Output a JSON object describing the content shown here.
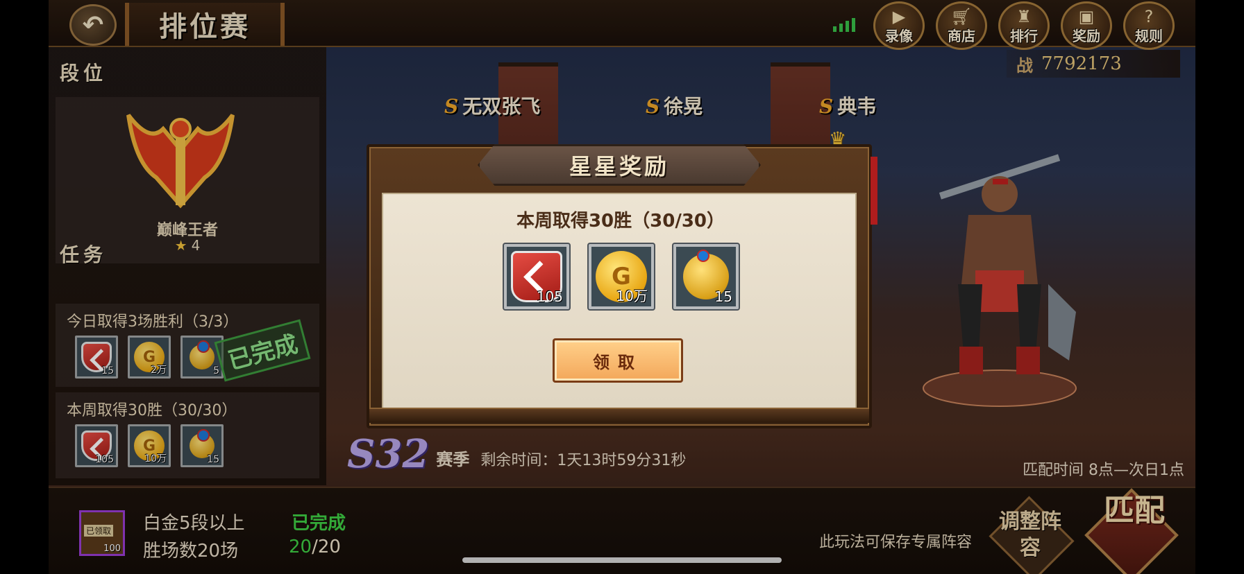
{
  "header": {
    "back_icon": "back-arrow-icon",
    "title": "排位赛",
    "buttons": [
      {
        "label": "录像",
        "icon": "video-icon"
      },
      {
        "label": "商店",
        "icon": "cart-icon"
      },
      {
        "label": "排行",
        "icon": "trophy-icon"
      },
      {
        "label": "奖励",
        "icon": "gift-icon"
      },
      {
        "label": "规则",
        "icon": "question-icon"
      }
    ],
    "power_label": "战",
    "power_value": "7792173"
  },
  "rank": {
    "section_label": "段位",
    "name": "巅峰王者",
    "stars": "4"
  },
  "tasks": {
    "section_label": "任务",
    "daily": {
      "title": "今日取得3场胜利（3/3）",
      "rewards": [
        {
          "item": "badge",
          "count": "15"
        },
        {
          "item": "coin",
          "count": "2万"
        },
        {
          "item": "medal",
          "count": "5"
        }
      ],
      "stamp": "已完成"
    },
    "weekly": {
      "title": "本周取得30胜（30/30）",
      "rewards": [
        {
          "item": "badge",
          "count": "105"
        },
        {
          "item": "coin",
          "count": "10万"
        },
        {
          "item": "medal",
          "count": "15"
        }
      ]
    }
  },
  "stage": {
    "heroes": [
      {
        "grade": "S",
        "name": "无双张飞"
      },
      {
        "grade": "S",
        "name": "徐晃"
      },
      {
        "grade": "S",
        "name": "典韦"
      }
    ],
    "season_number": "S32",
    "season_label": "赛季",
    "remaining": "剩余时间：1天13时59分31秒",
    "match_time": "匹配时间  8点—次日1点"
  },
  "bottom": {
    "claimed_tag": "已领取",
    "claimed_count": "100",
    "requirement_rank": "白金5段以上",
    "requirement_wins": "胜场数20场",
    "status": "已完成",
    "progress_current": "20",
    "progress_total": "/20",
    "save_note": "此玩法可保存专属阵容",
    "adjust_label": "调整阵容",
    "match_label": "匹配"
  },
  "modal": {
    "title": "星星奖励",
    "subtitle": "本周取得30胜（30/30）",
    "rewards": [
      {
        "item": "badge",
        "count": "105"
      },
      {
        "item": "coin",
        "count": "10万",
        "glyph": "G"
      },
      {
        "item": "medal",
        "count": "15"
      }
    ],
    "claim_label": "领取"
  },
  "colors": {
    "accent_gold": "#f3c13c",
    "complete_green": "#3fcf45",
    "button_orange": "#f3a75a"
  }
}
